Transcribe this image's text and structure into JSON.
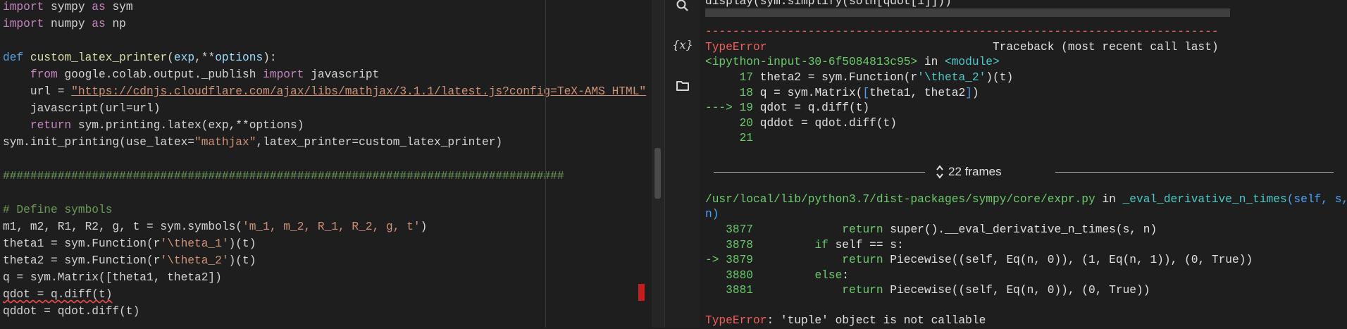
{
  "editor": {
    "lines": [
      [
        {
          "t": "import",
          "c": "kw"
        },
        {
          "t": " sympy "
        },
        {
          "t": "as",
          "c": "kw"
        },
        {
          "t": " sym"
        }
      ],
      [
        {
          "t": "import",
          "c": "kw"
        },
        {
          "t": " numpy "
        },
        {
          "t": "as",
          "c": "kw"
        },
        {
          "t": " np"
        }
      ],
      [],
      [
        {
          "t": "def",
          "c": "kwb"
        },
        {
          "t": " "
        },
        {
          "t": "custom_latex_printer",
          "c": "fn"
        },
        {
          "t": "("
        },
        {
          "t": "exp",
          "c": "param"
        },
        {
          "t": ",**"
        },
        {
          "t": "options",
          "c": "param"
        },
        {
          "t": "):"
        }
      ],
      [
        {
          "t": "    "
        },
        {
          "t": "from",
          "c": "kw"
        },
        {
          "t": " google.colab.output._publish "
        },
        {
          "t": "import",
          "c": "kw"
        },
        {
          "t": " javascript"
        }
      ],
      [
        {
          "t": "    url = "
        },
        {
          "t": "\"https://cdnjs.cloudflare.com/ajax/libs/mathjax/3.1.1/latest.js?config=TeX-AMS_HTML\"",
          "c": "str url"
        }
      ],
      [
        {
          "t": "    javascript(url=url)"
        }
      ],
      [
        {
          "t": "    "
        },
        {
          "t": "return",
          "c": "kw"
        },
        {
          "t": " sym.printing.latex(exp,**options)"
        }
      ],
      [
        {
          "t": "sym.init_printing(use_latex="
        },
        {
          "t": "\"mathjax\"",
          "c": "str"
        },
        {
          "t": ",latex_printer=custom_latex_printer)"
        }
      ],
      [],
      [
        {
          "t": "##################################################################################",
          "c": "hash"
        }
      ],
      [],
      [
        {
          "t": "# Define symbols",
          "c": "cmt"
        }
      ],
      [
        {
          "t": "m1, m2, R1, R2, g, t = sym.symbols("
        },
        {
          "t": "'m_1, m_2, R_1, R_2, g, t'",
          "c": "str"
        },
        {
          "t": ")"
        }
      ],
      [
        {
          "t": "theta1 = sym.Function(r"
        },
        {
          "t": "'\\theta_1'",
          "c": "str"
        },
        {
          "t": ")(t)"
        }
      ],
      [
        {
          "t": "theta2 = sym.Function(r"
        },
        {
          "t": "'\\theta_2'",
          "c": "str"
        },
        {
          "t": ")(t)"
        }
      ],
      [
        {
          "t": "q = sym.Matrix([theta1, theta2])"
        }
      ],
      [
        {
          "t": "qdot = q.diff(t)",
          "c": "squiggle"
        }
      ],
      [
        {
          "t": "qddot = qdot.diff(t)"
        }
      ]
    ]
  },
  "sidebar": {
    "icons": [
      "search-icon",
      "variables-icon",
      "folder-icon"
    ],
    "variables_label": "{x}"
  },
  "output": {
    "lines": [
      [
        {
          "t": "display(sym.simplify(soln[qdot[1]]))"
        }
      ],
      [],
      [
        {
          "t": "---------------------------------------------------------------------------",
          "c": "o-red"
        }
      ],
      [
        {
          "t": "TypeError",
          "c": "o-red"
        },
        {
          "t": "                                 Traceback (most recent call last)"
        }
      ],
      [
        {
          "t": "<ipython-input-30-6f5084813c95>",
          "c": "o-green"
        },
        {
          "t": " in "
        },
        {
          "t": "<module>",
          "c": "o-cyan"
        }
      ],
      [
        {
          "t": "     "
        },
        {
          "t": "17",
          "c": "o-green"
        },
        {
          "t": " theta2 = sym.Function(r"
        },
        {
          "t": "'\\theta_2'",
          "c": "o-cyan"
        },
        {
          "t": ")(t)"
        }
      ],
      [
        {
          "t": "     "
        },
        {
          "t": "18",
          "c": "o-green"
        },
        {
          "t": " q = sym.Matrix("
        },
        {
          "t": "[",
          "c": "o-blue"
        },
        {
          "t": "theta1, theta2"
        },
        {
          "t": "]",
          "c": "o-blue"
        },
        {
          "t": ")"
        }
      ],
      [
        {
          "t": "---> 19",
          "c": "o-green"
        },
        {
          "t": " qdot = q.diff(t)"
        }
      ],
      [
        {
          "t": "     "
        },
        {
          "t": "20",
          "c": "o-green"
        },
        {
          "t": " qddot = qdot.diff(t)"
        }
      ],
      [
        {
          "t": "     "
        },
        {
          "t": "21",
          "c": "o-green"
        }
      ],
      [],
      [],
      [],
      [
        {
          "t": "/usr/local/lib/python3.7/dist-packages/sympy/core/expr.py",
          "c": "o-green"
        },
        {
          "t": " in "
        },
        {
          "t": "_eval_derivative_n_times",
          "c": "o-cyan"
        },
        {
          "t": "(self, s,",
          "c": "o-blue"
        }
      ],
      [
        {
          "t": "n)",
          "c": "o-blue"
        }
      ],
      [
        {
          "t": "   3877",
          "c": "o-green"
        },
        {
          "t": "             "
        },
        {
          "t": "return",
          "c": "o-green"
        },
        {
          "t": " super().__eval_derivative_n_times(s, n)"
        }
      ],
      [
        {
          "t": "   3878",
          "c": "o-green"
        },
        {
          "t": "         "
        },
        {
          "t": "if",
          "c": "o-green"
        },
        {
          "t": " self == s:"
        }
      ],
      [
        {
          "t": "-> 3879",
          "c": "o-green"
        },
        {
          "t": "             "
        },
        {
          "t": "return",
          "c": "o-green"
        },
        {
          "t": " Piecewise((self, Eq(n, 0)), (1, Eq(n, 1)), (0, True))"
        }
      ],
      [
        {
          "t": "   3880",
          "c": "o-green"
        },
        {
          "t": "         "
        },
        {
          "t": "else",
          "c": "o-green"
        },
        {
          "t": ":"
        }
      ],
      [
        {
          "t": "   3881",
          "c": "o-green"
        },
        {
          "t": "             "
        },
        {
          "t": "return",
          "c": "o-green"
        },
        {
          "t": " Piecewise((self, Eq(n, 0)), (0, True))"
        }
      ],
      [],
      [
        {
          "t": "TypeError",
          "c": "o-red"
        },
        {
          "t": ": 'tuple' object is not callable"
        }
      ]
    ],
    "frames_label": "22 frames"
  }
}
